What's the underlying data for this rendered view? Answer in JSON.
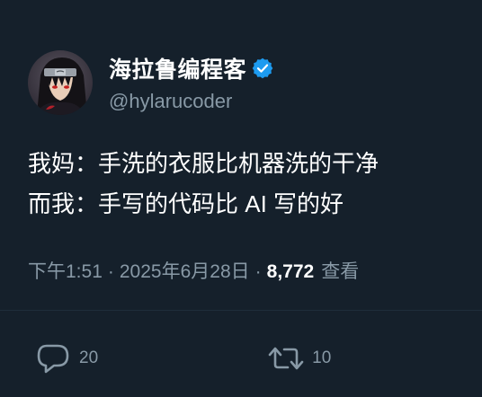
{
  "top_fragment": "˙˙˙",
  "author": {
    "display_name": "海拉鲁编程客",
    "handle": "@hylarucoder",
    "verified": true,
    "verified_color": "#1d9bf0"
  },
  "tweet": {
    "lines": [
      "我妈：手洗的衣服比机器洗的干净",
      "而我：手写的代码比 AI 写的好"
    ]
  },
  "meta": {
    "time": "下午1:51",
    "separator": "·",
    "date": "2025年6月28日",
    "views_count": "8,772",
    "views_label": "查看"
  },
  "actions": {
    "reply_count": "20",
    "retweet_count": "10"
  },
  "icons": {
    "reply": "reply-icon",
    "retweet": "retweet-icon",
    "verified": "verified-badge-icon"
  },
  "colors": {
    "background": "#15202b",
    "secondary_text": "#8899a6",
    "primary_text": "#ffffff"
  }
}
